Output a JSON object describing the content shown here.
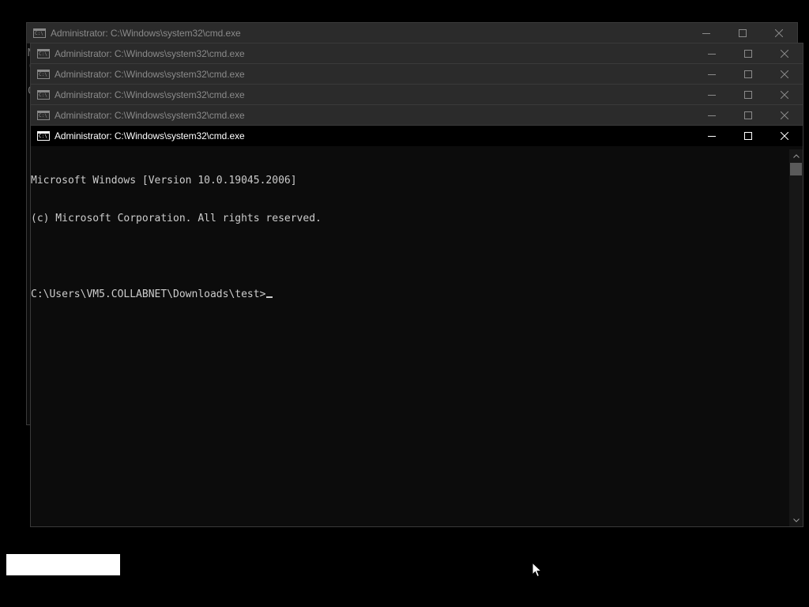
{
  "colors": {
    "desktop_background": "#000000",
    "console_background": "#0c0c0c",
    "console_text": "#cccccc",
    "inactive_titlebar": "#2b2b2b",
    "active_titlebar": "#000000"
  },
  "windows": [
    {
      "title": "Administrator: C:\\Windows\\system32\\cmd.exe",
      "state": "inactive"
    },
    {
      "title": "Administrator: C:\\Windows\\system32\\cmd.exe",
      "state": "inactive"
    },
    {
      "title": "Administrator: C:\\Windows\\system32\\cmd.exe",
      "state": "inactive"
    },
    {
      "title": "Administrator: C:\\Windows\\system32\\cmd.exe",
      "state": "inactive"
    },
    {
      "title": "Administrator: C:\\Windows\\system32\\cmd.exe",
      "state": "inactive"
    },
    {
      "title": "Administrator: C:\\Windows\\system32\\cmd.exe",
      "state": "active"
    }
  ],
  "app_icon": {
    "name": "cmd-icon",
    "glyph": "C:\\"
  },
  "caption_buttons": {
    "minimize_icon": "minimize-icon",
    "maximize_icon": "maximize-icon",
    "close_icon": "close-icon"
  },
  "console": {
    "lines": [
      "Microsoft Windows [Version 10.0.19045.2006]",
      "(c) Microsoft Corporation. All rights reserved.",
      "",
      "C:\\Users\\VM5.COLLABNET\\Downloads\\test>"
    ]
  },
  "background_window_peek": {
    "chars": [
      "M",
      "(",
      "C"
    ]
  }
}
